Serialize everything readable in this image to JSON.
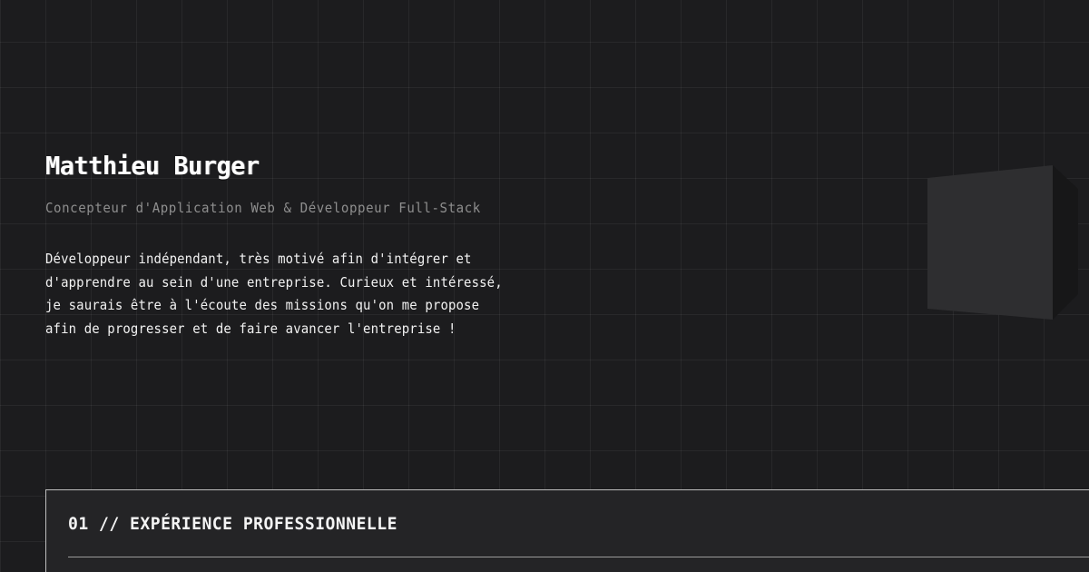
{
  "hero": {
    "name": "Matthieu Burger",
    "subtitle": "Concepteur d'Application Web & Développeur Full-Stack",
    "bio_lines": [
      "Développeur indépendant, très motivé afin d'intégrer et",
      "d'apprendre au sein d'une entreprise. Curieux et intéressé,",
      "je saurais être à l'écoute des missions qu'on me propose",
      "afin de progresser et de faire avancer l'entreprise !"
    ]
  },
  "decoration": {
    "icon": "cube-icon",
    "front_color": "#2e2e30",
    "side_color": "#171718"
  },
  "section": {
    "title": "01 // EXPÉRIENCE PROFESSIONNELLE"
  },
  "colors": {
    "background": "#1c1c1e",
    "text": "#f2f2f2",
    "muted": "#8e8e8e",
    "section_bg": "#242426",
    "section_border": "#bdbdbd"
  }
}
